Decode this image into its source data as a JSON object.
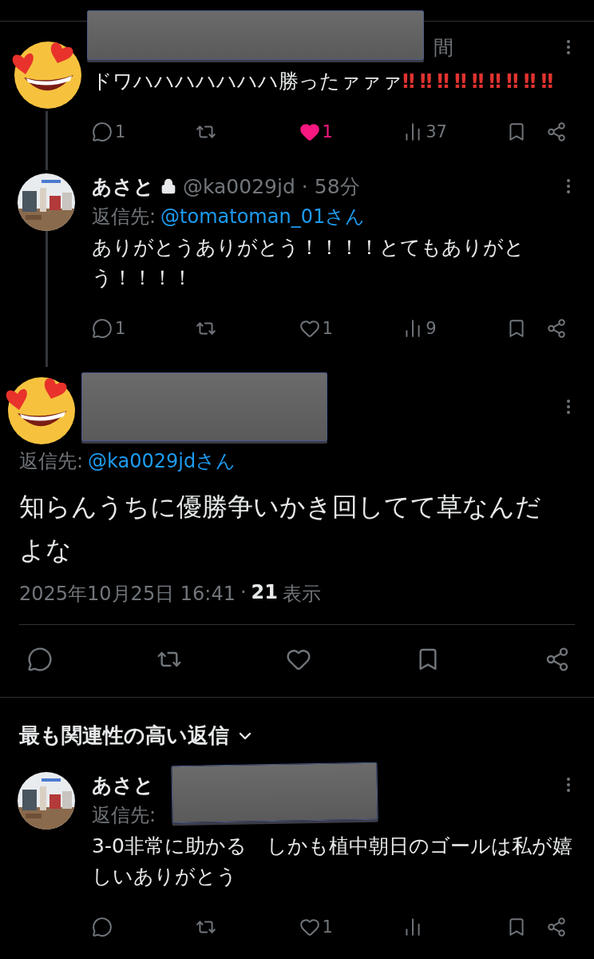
{
  "thread": [
    {
      "avatar": {
        "kind": "sticker"
      },
      "redacted": true,
      "header_tail": "間",
      "text": "ドワハハハハハハハ勝ったァァァ",
      "emphasis": "‼‼‼‼‼‼‼‼‼",
      "actions": [
        {
          "kind": "reply",
          "count": "1"
        },
        {
          "kind": "repost"
        },
        {
          "kind": "like",
          "count": "1",
          "selected": true
        },
        {
          "kind": "views",
          "count": "37"
        },
        {
          "kind": "bookmark"
        },
        {
          "kind": "share"
        }
      ]
    },
    {
      "name": "あさと",
      "protected": true,
      "handle": "@ka0029jd",
      "separator": "·",
      "time": "58分",
      "reply_label": "返信先:",
      "reply_to": "@tomatoman_01さん",
      "text": "ありがとうありがとう！！！！とてもありがとう！！！！",
      "actions": [
        {
          "kind": "reply",
          "count": "1"
        },
        {
          "kind": "repost"
        },
        {
          "kind": "like",
          "count": "1",
          "selected": false
        },
        {
          "kind": "views",
          "count": "9"
        },
        {
          "kind": "bookmark"
        },
        {
          "kind": "share"
        }
      ]
    }
  ],
  "focus": {
    "avatar": {
      "kind": "sticker"
    },
    "redacted": true,
    "reply_label": "返信先:",
    "reply_to": "@ka0029jdさん",
    "text": "知らんうちに優勝争いかき回してて草なんだよな",
    "date": "2025年10月25日 16:41",
    "separator": "·",
    "views": "21",
    "views_label": "表示",
    "actions": [
      {
        "kind": "reply"
      },
      {
        "kind": "repost"
      },
      {
        "kind": "like",
        "selected": false
      },
      {
        "kind": "bookmark"
      },
      {
        "kind": "share"
      }
    ]
  },
  "section": {
    "title": "最も関連性の高い返信"
  },
  "replies": [
    {
      "name": "あさと",
      "redacted": true,
      "reply_label": "返信先:",
      "text": "3-0非常に助かる　しかも植中朝日のゴールは私が嬉しいありがとう",
      "actions": [
        {
          "kind": "reply"
        },
        {
          "kind": "repost"
        },
        {
          "kind": "like",
          "count": "1",
          "selected": false
        },
        {
          "kind": "views"
        },
        {
          "kind": "bookmark"
        },
        {
          "kind": "share"
        }
      ]
    }
  ]
}
